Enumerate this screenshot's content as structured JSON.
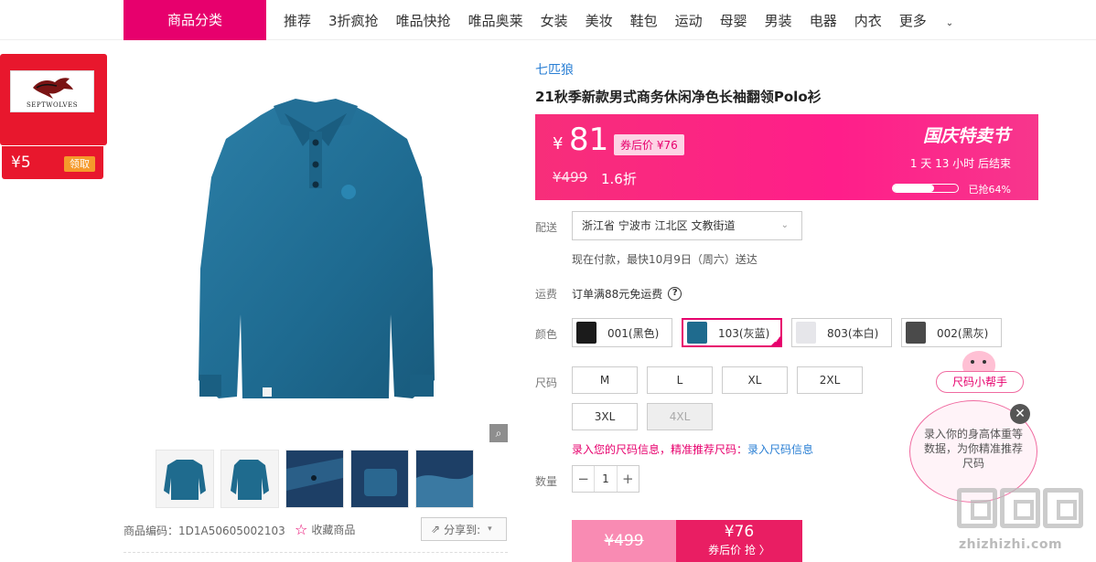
{
  "nav": {
    "category_label": "商品分类",
    "links": [
      "推荐",
      "3折疯抢",
      "唯品快抢",
      "唯品奥莱",
      "女装",
      "美妆",
      "鞋包",
      "运动",
      "母婴",
      "男装",
      "电器",
      "内衣",
      "更多"
    ]
  },
  "coupon": {
    "brand_logo_text": "SEPTWOLVES",
    "amount": "¥5",
    "claim_label": "领取"
  },
  "gallery": {
    "zoom_icon": "zoom-icon",
    "thumb_count": 5
  },
  "meta": {
    "code_label": "商品编码：",
    "code_value": "1D1A50605002103",
    "favorite_label": "收藏商品",
    "share_label": "分享到:"
  },
  "product": {
    "brand": "七匹狼",
    "title": "21秋季新款男式商务休闲净色长袖翻领Polo衫"
  },
  "price": {
    "currency": "¥",
    "current": "81",
    "after_coupon": "券后价 ¥76",
    "original": "¥499",
    "discount": "1.6折",
    "festival": "国庆特卖节",
    "countdown": "1 天 13 小时 后结束",
    "sold_pct": 64,
    "sold_label": "已抢64%"
  },
  "delivery": {
    "label": "配送",
    "address": "浙江省 宁波市 江北区 文教街道",
    "note": "现在付款，最快10月9日（周六）送达"
  },
  "shipping": {
    "label": "运费",
    "text": "订单满88元免运费"
  },
  "colors": {
    "label": "颜色",
    "options": [
      {
        "name": "001(黑色)",
        "swatch": "#1b1b1b"
      },
      {
        "name": "103(灰蓝)",
        "swatch": "#1f6b8e",
        "selected": true
      },
      {
        "name": "803(本白)",
        "swatch": "#ececec"
      },
      {
        "name": "002(黑灰)",
        "swatch": "#4a4a4a"
      }
    ]
  },
  "sizes": {
    "label": "尺码",
    "options": [
      {
        "name": "M"
      },
      {
        "name": "L"
      },
      {
        "name": "XL"
      },
      {
        "name": "2XL"
      },
      {
        "name": "3XL"
      },
      {
        "name": "4XL",
        "disabled": true
      }
    ],
    "tip": "录入您的尺码信息，精准推荐尺码：",
    "tip_link": "录入尺码信息"
  },
  "quantity": {
    "label": "数量",
    "value": "1",
    "minus": "−",
    "plus": "+"
  },
  "buy": {
    "original_price": "¥499",
    "coupon_price": "¥76",
    "coupon_action": "券后价 抢 〉"
  },
  "helper": {
    "tag": "尺码小帮手",
    "bubble_text": "录入你的身高体重等数据，为你精准推荐尺码",
    "close": "✕"
  },
  "watermark": {
    "url": "zhizhizhi.com"
  },
  "theme": {
    "accent": "#e7006d",
    "link": "#2a7fd4"
  }
}
